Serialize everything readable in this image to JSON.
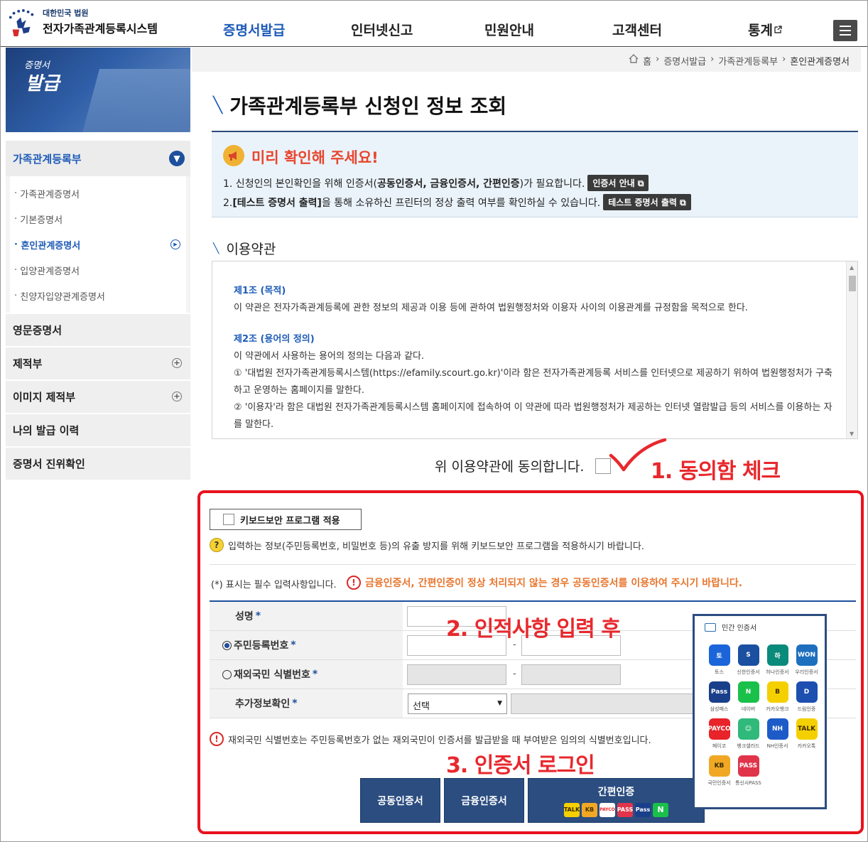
{
  "header": {
    "logo_sub": "대한민국 법원",
    "logo_main": "전자가족관계등록시스템",
    "nav": [
      "증명서발급",
      "인터넷신고",
      "민원안내",
      "고객센터",
      "통계"
    ],
    "menu_icon": "hamburger-menu-icon"
  },
  "sidebar": {
    "banner_line1": "증명서",
    "banner_line2": "발급",
    "section_title": "가족관계등록부",
    "sub_items": [
      "가족관계증명서",
      "기본증명서",
      "혼인관계증명서",
      "입양관계증명서",
      "친양자입양관계증명서"
    ],
    "items": [
      "영문증명서",
      "제적부",
      "이미지 제적부",
      "나의 발급 이력",
      "증명서 진위확인"
    ]
  },
  "breadcrumb": [
    "홈",
    "증명서발급",
    "가족관계등록부",
    "혼인관계증명서"
  ],
  "page": {
    "title": "가족관계등록부 신청인 정보 조회"
  },
  "notice": {
    "heading": "미리 확인해 주세요!",
    "line1_pre": "1. 신청인의 본인확인을 위해 인증서(",
    "line1_bold": "공동인증서, 금융인증서, 간편인증",
    "line1_post": ")가 필요합니다.",
    "line1_btn": "인증서 안내",
    "line2_pre": "2.",
    "line2_bold": "[테스트 증명서 출력]",
    "line2_post": "을 통해 소유하신 프린터의 정상 출력 여부를 확인하실 수 있습니다.",
    "line2_btn": "테스트 증명서 출력"
  },
  "terms": {
    "section_title": "이용약관",
    "art1_title": "제1조 (목적)",
    "art1_text": "이 약관은 전자가족관계등록에 관한 정보의 제공과 이용 등에 관하여 법원행정처와 이용자 사이의 이용관계를 규정함을 목적으로 한다.",
    "art2_title": "제2조 (용어의 정의)",
    "art2_text": "이 약관에서 사용하는 용어의 정의는 다음과 같다.",
    "art2_item1": "① '대법원 전자가족관계등록시스템(https://efamily.scourt.go.kr)'이라 함은 전자가족관계등록 서비스를 인터넷으로 제공하기 위하여 법원행정처가 구축하고 운영하는 홈페이지를 말한다.",
    "art2_item2": "② '이용자'라 함은 대법원 전자가족관계등록시스템 홈페이지에 접속하여 이 약관에 따라 법원행정처가 제공하는 인터넷 열람발급 등의 서비스를 이용하는 자를 말한다."
  },
  "agree_label": "위 이용약관에 동의합니다.",
  "annotations": {
    "step1": "1. 동의함 체크",
    "step2": "2. 인적사항 입력 후",
    "step3": "3. 인증서 로그인"
  },
  "security": {
    "kb_button": "키보드보안 프로그램 적용",
    "kb_note": "입력하는 정보(주민등록번호, 비밀번호 등)의 유출 방지를 위해 키보드보안 프로그램을 적용하시기 바랍니다."
  },
  "form": {
    "required_note": "(*) 표시는 필수 입력사항입니다.",
    "warning": "금융인증서, 간편인증이 정상 처리되지 않는 경우 공동인증서를 이용하여 주시기 바랍니다.",
    "name_label": "성명",
    "rrn_label": "주민등록번호",
    "foreign_label": "재외국민 식별번호",
    "extra_label": "추가정보확인",
    "select_value": "선택",
    "foreign_note": "재외국민 식별번호는 주민등록번호가 없는 재외국민이 인증서를 발급받을 때 부여받은 임의의 식별번호입니다."
  },
  "cert_buttons": {
    "joint": "공동인증서",
    "financial": "금융인증서",
    "simple": "간편인증",
    "simple_icons": [
      "TALK",
      "KB",
      "PAYCO",
      "PASS",
      "Pass",
      "N"
    ]
  },
  "popup": {
    "title": "민간 인증서",
    "providers": [
      {
        "icon": "토",
        "label": "토스",
        "color": "#1b64da"
      },
      {
        "icon": "S",
        "label": "신한인증서",
        "color": "#1b4fa0"
      },
      {
        "icon": "하",
        "label": "하나인증서",
        "color": "#0a8a7a"
      },
      {
        "icon": "WON",
        "label": "우리인증서",
        "color": "#1f6fbf"
      },
      {
        "icon": "Pass",
        "label": "삼성패스",
        "color": "#1a3f8a"
      },
      {
        "icon": "N",
        "label": "네이버",
        "color": "#19c04a"
      },
      {
        "icon": "B",
        "label": "카카오뱅크",
        "color": "#f5d000"
      },
      {
        "icon": "D",
        "label": "드림인증",
        "color": "#1d4fb0"
      },
      {
        "icon": "PAYCO",
        "label": "페이코",
        "color": "#e8232a"
      },
      {
        "icon": "☺",
        "label": "뱅크샐러드",
        "color": "#2fb97a"
      },
      {
        "icon": "NH",
        "label": "NH인증서",
        "color": "#1d5bc8"
      },
      {
        "icon": "TALK",
        "label": "카카오톡",
        "color": "#f5d000"
      },
      {
        "icon": "KB",
        "label": "국민인증서",
        "color": "#f0a824"
      },
      {
        "icon": "PASS",
        "label": "통신사PASS",
        "color": "#e0344a"
      }
    ]
  }
}
